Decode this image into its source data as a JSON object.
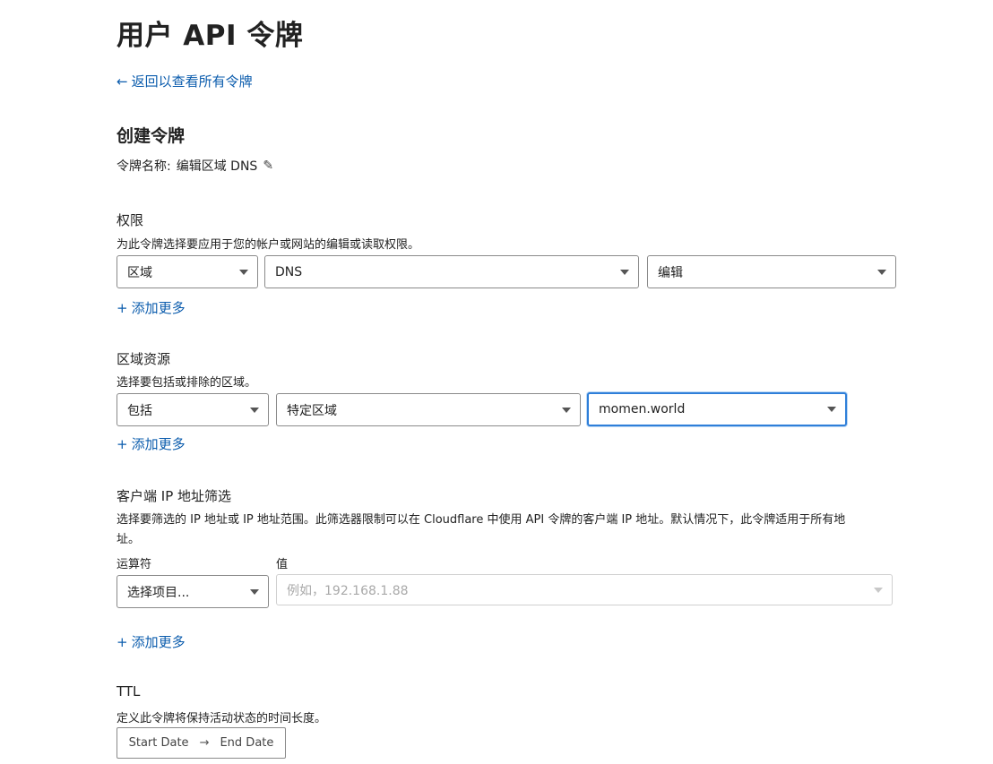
{
  "page": {
    "title": "用户 API 令牌",
    "back_link": "返回以查看所有令牌"
  },
  "create": {
    "heading": "创建令牌",
    "token_name_label": "令牌名称:",
    "token_name_value": "编辑区域 DNS"
  },
  "permissions": {
    "label": "权限",
    "description": "为此令牌选择要应用于您的帐户或网站的编辑或读取权限。",
    "selects": [
      "区域",
      "DNS",
      "编辑"
    ],
    "add_more": "添加更多"
  },
  "zone_resources": {
    "label": "区域资源",
    "description": "选择要包括或排除的区域。",
    "selects": [
      "包括",
      "特定区域",
      "momen.world"
    ],
    "add_more": "添加更多"
  },
  "ip_filter": {
    "label": "客户端 IP 地址筛选",
    "description_line1": "选择要筛选的 IP 地址或 IP 地址范围。此筛选器限制可以在 Cloudflare 中使用 API 令牌的客户端 IP 地址。默认情况下，此令牌适用于所有地",
    "description_line2": "址。",
    "operator_label": "运算符",
    "value_label": "值",
    "operator_placeholder": "选择项目...",
    "value_placeholder": "例如，192.168.1.88",
    "add_more": "添加更多"
  },
  "ttl": {
    "label": "TTL",
    "description": "定义此令牌将保持活动状态的时间长度。",
    "start_date": "Start Date",
    "end_date": "End Date"
  },
  "icons": {
    "back": "arrow-left-icon",
    "edit": "pencil-icon",
    "add": "plus-icon",
    "dropdown": "caret-down-icon",
    "range": "arrow-right-icon"
  },
  "colors": {
    "link": "#0b5cad",
    "focus": "#2f7fd9",
    "border": "#8a8a8a"
  }
}
